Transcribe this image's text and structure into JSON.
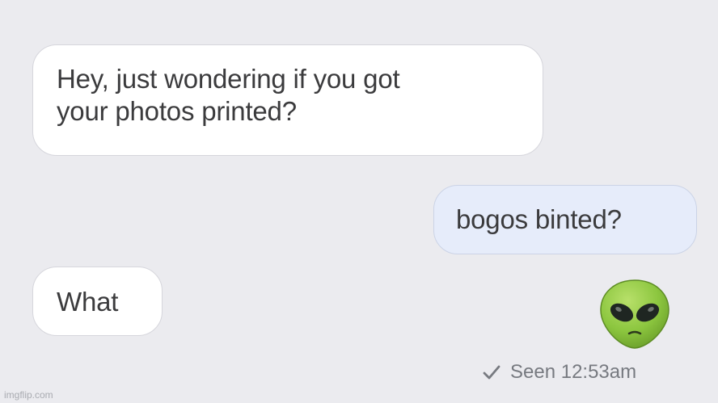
{
  "conversation": {
    "messages": [
      {
        "direction": "incoming",
        "lines": [
          "Hey, just wondering if you got",
          "your photos printed?"
        ]
      },
      {
        "direction": "outgoing",
        "lines": [
          "bogos binted?"
        ]
      },
      {
        "direction": "incoming",
        "lines": [
          "What"
        ]
      }
    ],
    "reaction": {
      "icon": "alien-icon",
      "color": "#8cc63f"
    },
    "read_receipt": {
      "icon": "checkmark-icon",
      "text": "Seen 12:53am"
    }
  },
  "watermark": {
    "text": "imgflip.com"
  },
  "colors": {
    "background": "#ebebef",
    "incoming_bubble": "#ffffff",
    "outgoing_bubble": "#e6ecfa",
    "message_text": "#3b3b3d",
    "receipt_text": "#777a80"
  }
}
